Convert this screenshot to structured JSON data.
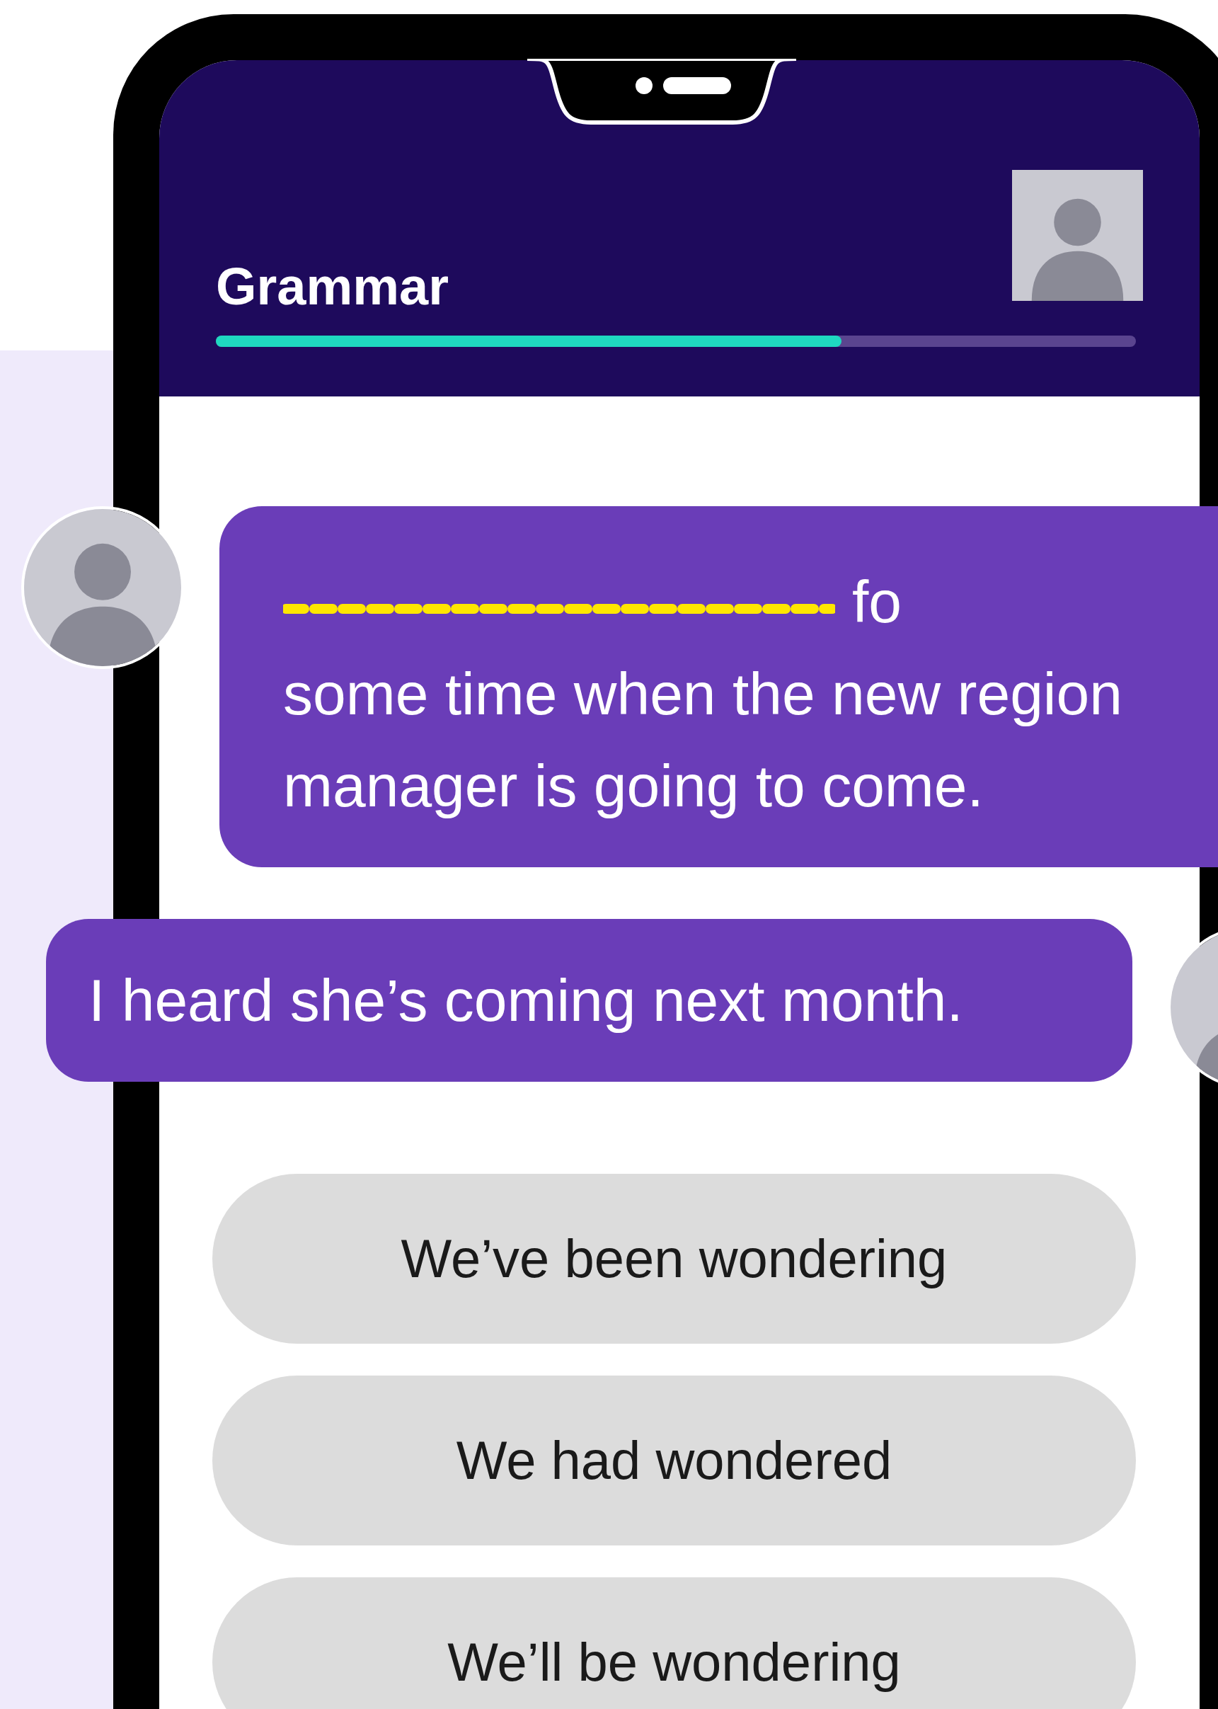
{
  "header": {
    "title": "Grammar",
    "progress": {
      "level": 0.68
    }
  },
  "messages": [
    {
      "kind": "incoming",
      "blank": true,
      "lines": [
        "fo",
        "some time when the new region",
        "manager is going to come."
      ]
    },
    {
      "kind": "outgoing",
      "blank": false,
      "lines": [
        "I heard she’s coming next month."
      ]
    }
  ],
  "options": [
    {
      "label": "We’ve been wondering"
    },
    {
      "label": "We had wondered"
    },
    {
      "label": "We’ll be wondering"
    }
  ]
}
